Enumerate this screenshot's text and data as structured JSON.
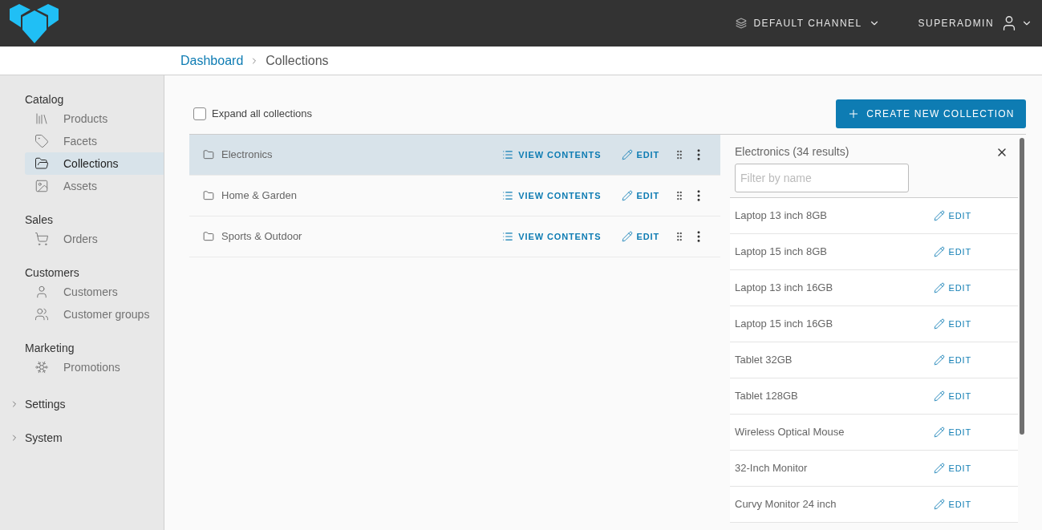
{
  "header": {
    "channel": "DEFAULT CHANNEL",
    "user": "SUPERADMIN"
  },
  "breadcrumb": [
    "Dashboard",
    "Collections"
  ],
  "sidebar": {
    "sections": [
      {
        "title": "Catalog",
        "kind": "group",
        "items": [
          {
            "label": "Products",
            "selected": false
          },
          {
            "label": "Facets",
            "selected": false
          },
          {
            "label": "Collections",
            "selected": true
          },
          {
            "label": "Assets",
            "selected": false
          }
        ]
      },
      {
        "title": "Sales",
        "kind": "group",
        "items": [
          {
            "label": "Orders",
            "selected": false
          }
        ]
      },
      {
        "title": "Customers",
        "kind": "group",
        "items": [
          {
            "label": "Customers",
            "selected": false
          },
          {
            "label": "Customer groups",
            "selected": false
          }
        ]
      },
      {
        "title": "Marketing",
        "kind": "group",
        "items": [
          {
            "label": "Promotions",
            "selected": false
          }
        ]
      },
      {
        "title": "Settings",
        "kind": "collapsible",
        "expanded": false
      },
      {
        "title": "System",
        "kind": "collapsible",
        "expanded": false
      }
    ]
  },
  "toolbar": {
    "expand_all": {
      "label": "Expand all collections",
      "checked": false
    },
    "create_button": "CREATE NEW COLLECTION"
  },
  "collections": [
    {
      "name": "Electronics",
      "selected": true,
      "view_contents": "VIEW CONTENTS",
      "edit": "EDIT"
    },
    {
      "name": "Home & Garden",
      "selected": false,
      "view_contents": "VIEW CONTENTS",
      "edit": "EDIT"
    },
    {
      "name": "Sports & Outdoor",
      "selected": false,
      "view_contents": "VIEW CONTENTS",
      "edit": "EDIT"
    }
  ],
  "contents_panel": {
    "title": "Electronics (34 results)",
    "filter": {
      "placeholder": "Filter by name"
    },
    "rows": [
      {
        "name": "Laptop 13 inch 8GB",
        "edit": "EDIT"
      },
      {
        "name": "Laptop 15 inch 8GB",
        "edit": "EDIT"
      },
      {
        "name": "Laptop 13 inch 16GB",
        "edit": "EDIT"
      },
      {
        "name": "Laptop 15 inch 16GB",
        "edit": "EDIT"
      },
      {
        "name": "Tablet 32GB",
        "edit": "EDIT"
      },
      {
        "name": "Tablet 128GB",
        "edit": "EDIT"
      },
      {
        "name": "Wireless Optical Mouse",
        "edit": "EDIT"
      },
      {
        "name": "32-Inch Monitor",
        "edit": "EDIT"
      },
      {
        "name": "Curvy Monitor 24 inch",
        "edit": "EDIT"
      }
    ]
  }
}
